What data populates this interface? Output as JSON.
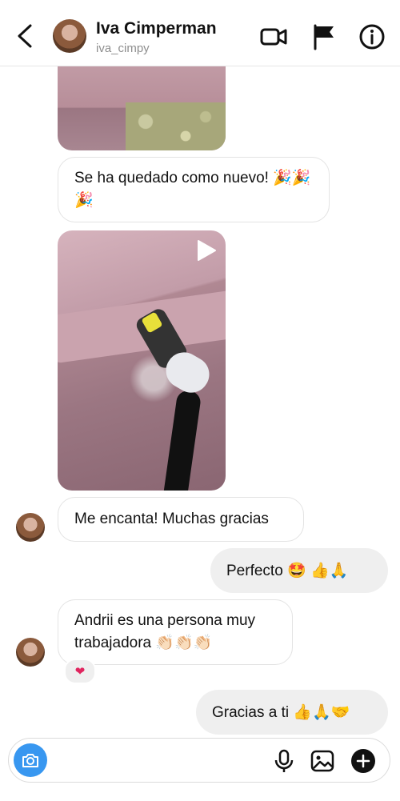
{
  "header": {
    "name": "Iva Cimperman",
    "username": "iva_cimpy"
  },
  "messages": {
    "m1": "Se ha quedado como nuevo! 🎉🎉🎉",
    "m2": "Me encanta! Muchas gracias",
    "m3": "Perfecto 🤩 👍🙏",
    "m4_line1": "Andrii es una persona muy",
    "m4_line2": "trabajadora 👏🏻👏🏻👏🏻",
    "m4_reaction": "❤",
    "m5": "Gracias a ti 👍🙏🤝"
  },
  "colors": {
    "accent": "#3897f0",
    "outgoing_bubble": "#efefef",
    "incoming_border": "#e3e3e3",
    "heart": "#e0245e"
  },
  "icons": {
    "back": "chevron-left-icon",
    "video": "video-camera-icon",
    "flag": "flag-icon",
    "info": "info-icon",
    "camera": "camera-icon",
    "mic": "microphone-icon",
    "gallery": "image-icon",
    "plus": "plus-circle-icon",
    "play": "play-icon"
  }
}
